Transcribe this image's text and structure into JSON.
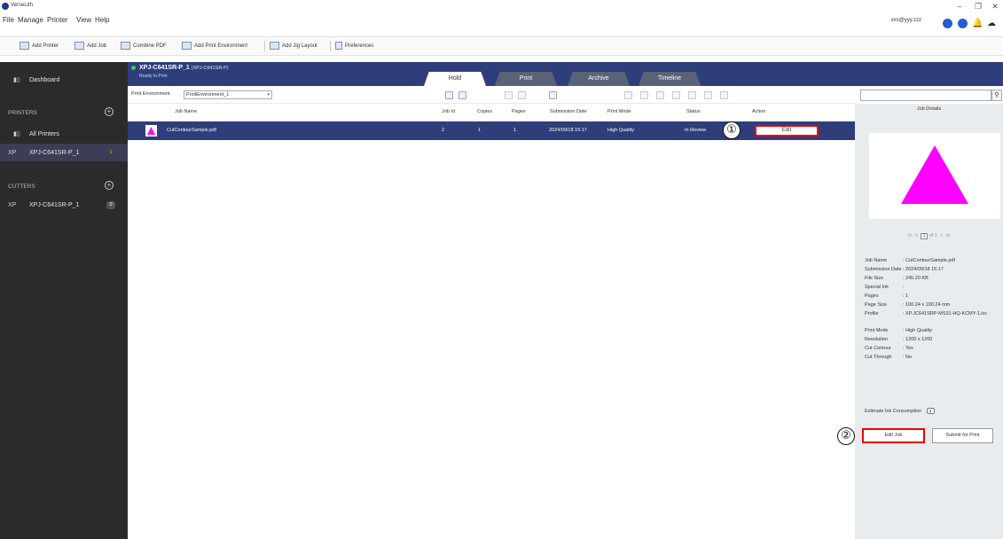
{
  "window": {
    "app_title": "VerseLith",
    "minimize_glyph": "–",
    "maximize_glyph": "❐",
    "close_glyph": "✕"
  },
  "menu": [
    "File",
    "Manage",
    "Printer",
    "View",
    "Help"
  ],
  "header": {
    "user": "xxx@yyy.zzz",
    "icons": [
      "account-icon",
      "settings-icon",
      "bell-icon",
      "cloud-icon"
    ],
    "bell_glyph": "🔔",
    "cloud_glyph": "☁"
  },
  "toolbar": {
    "add_printer": "Add Printer",
    "add_job": "Add Job",
    "combine_pdf": "Combine PDF",
    "add_print_environment": "Add Print Environment",
    "add_jig_layout": "Add Jig Layout",
    "preferences": "Preferences"
  },
  "sidebar": {
    "dashboard": "Dashboard",
    "dashboard_icon": "▮▯",
    "printers_section": "PRINTERS",
    "all_printers": "All Printers",
    "all_printers_icon": "▮▯",
    "printer_prefix": "XP",
    "printer_item": "XPJ-C641SR-P_1",
    "printer_count": "1",
    "cutters_section": "CUTTERS",
    "cutter_prefix": "XP",
    "cutter_item": "XPJ-C641SR-P_1",
    "cutter_count": "0",
    "plus_glyph": "+"
  },
  "printer_header": {
    "name": "XPJ-C641SR-P_1",
    "model": "(XPJ-C641SR-P)",
    "status": "Ready to Print"
  },
  "tabs": [
    "Hold",
    "Print",
    "Archive",
    "Timeline"
  ],
  "env": {
    "label": "Print Environment",
    "value": "PrintEnvironment_1",
    "chevron": "▾"
  },
  "search": {
    "button_glyph": "⚲"
  },
  "columns": {
    "job_name": "Job Name",
    "job_id": "Job Id",
    "copies": "Copies",
    "pages": "Pages",
    "submission_date": "Submission Date",
    "print_mode": "Print Mode",
    "status": "Status",
    "action": "Action"
  },
  "jobs": [
    {
      "name": "CutContourSample.pdf",
      "id": "2",
      "copies": "1",
      "pages": "1",
      "submission_date": "2024/09/18 15:17",
      "print_mode": "High Quality",
      "status": "In Review",
      "action": "Edit"
    }
  ],
  "callouts": {
    "one": "①",
    "two": "②"
  },
  "details": {
    "header": "Job Details",
    "pager": {
      "first": "|<",
      "prev": "<",
      "page": "1",
      "of": "of 1",
      "next": ">",
      "last": ">|"
    },
    "fields": [
      {
        "key": "Job Name",
        "value": ": CutContourSample.pdf"
      },
      {
        "key": "Submission Date",
        "value": ": 2024/09/18 15:17"
      },
      {
        "key": "File Size",
        "value": ": 245.20 KB"
      },
      {
        "key": "Special Ink",
        "value": ":"
      },
      {
        "key": "Pages",
        "value": ": 1"
      },
      {
        "key": "Page Size",
        "value": ": 100.24 x 100.24 mm"
      },
      {
        "key": "Profile",
        "value": ": XP.JC641SRP-MS31-HQ-KCMY-1.icc"
      },
      {
        "key": "Print Mode",
        "value": ": High Quality"
      },
      {
        "key": "Resolution",
        "value": ": 1200 x 1200"
      },
      {
        "key": "Cut Contour",
        "value": ": Yes"
      },
      {
        "key": "Cut Through",
        "value": ": No"
      }
    ],
    "estimate_label": "Estimate Ink Consumption",
    "estimate_glyph": "●",
    "edit_job": "Edit Job",
    "submit_for_print": "Submit for Print"
  },
  "colors": {
    "sidebar_bg": "#2b2b2b",
    "header_blue": "#2e3e7a",
    "selected_row": "#2e3e7a",
    "highlight_red": "#e00000",
    "preview_magenta": "#ff00ff"
  }
}
